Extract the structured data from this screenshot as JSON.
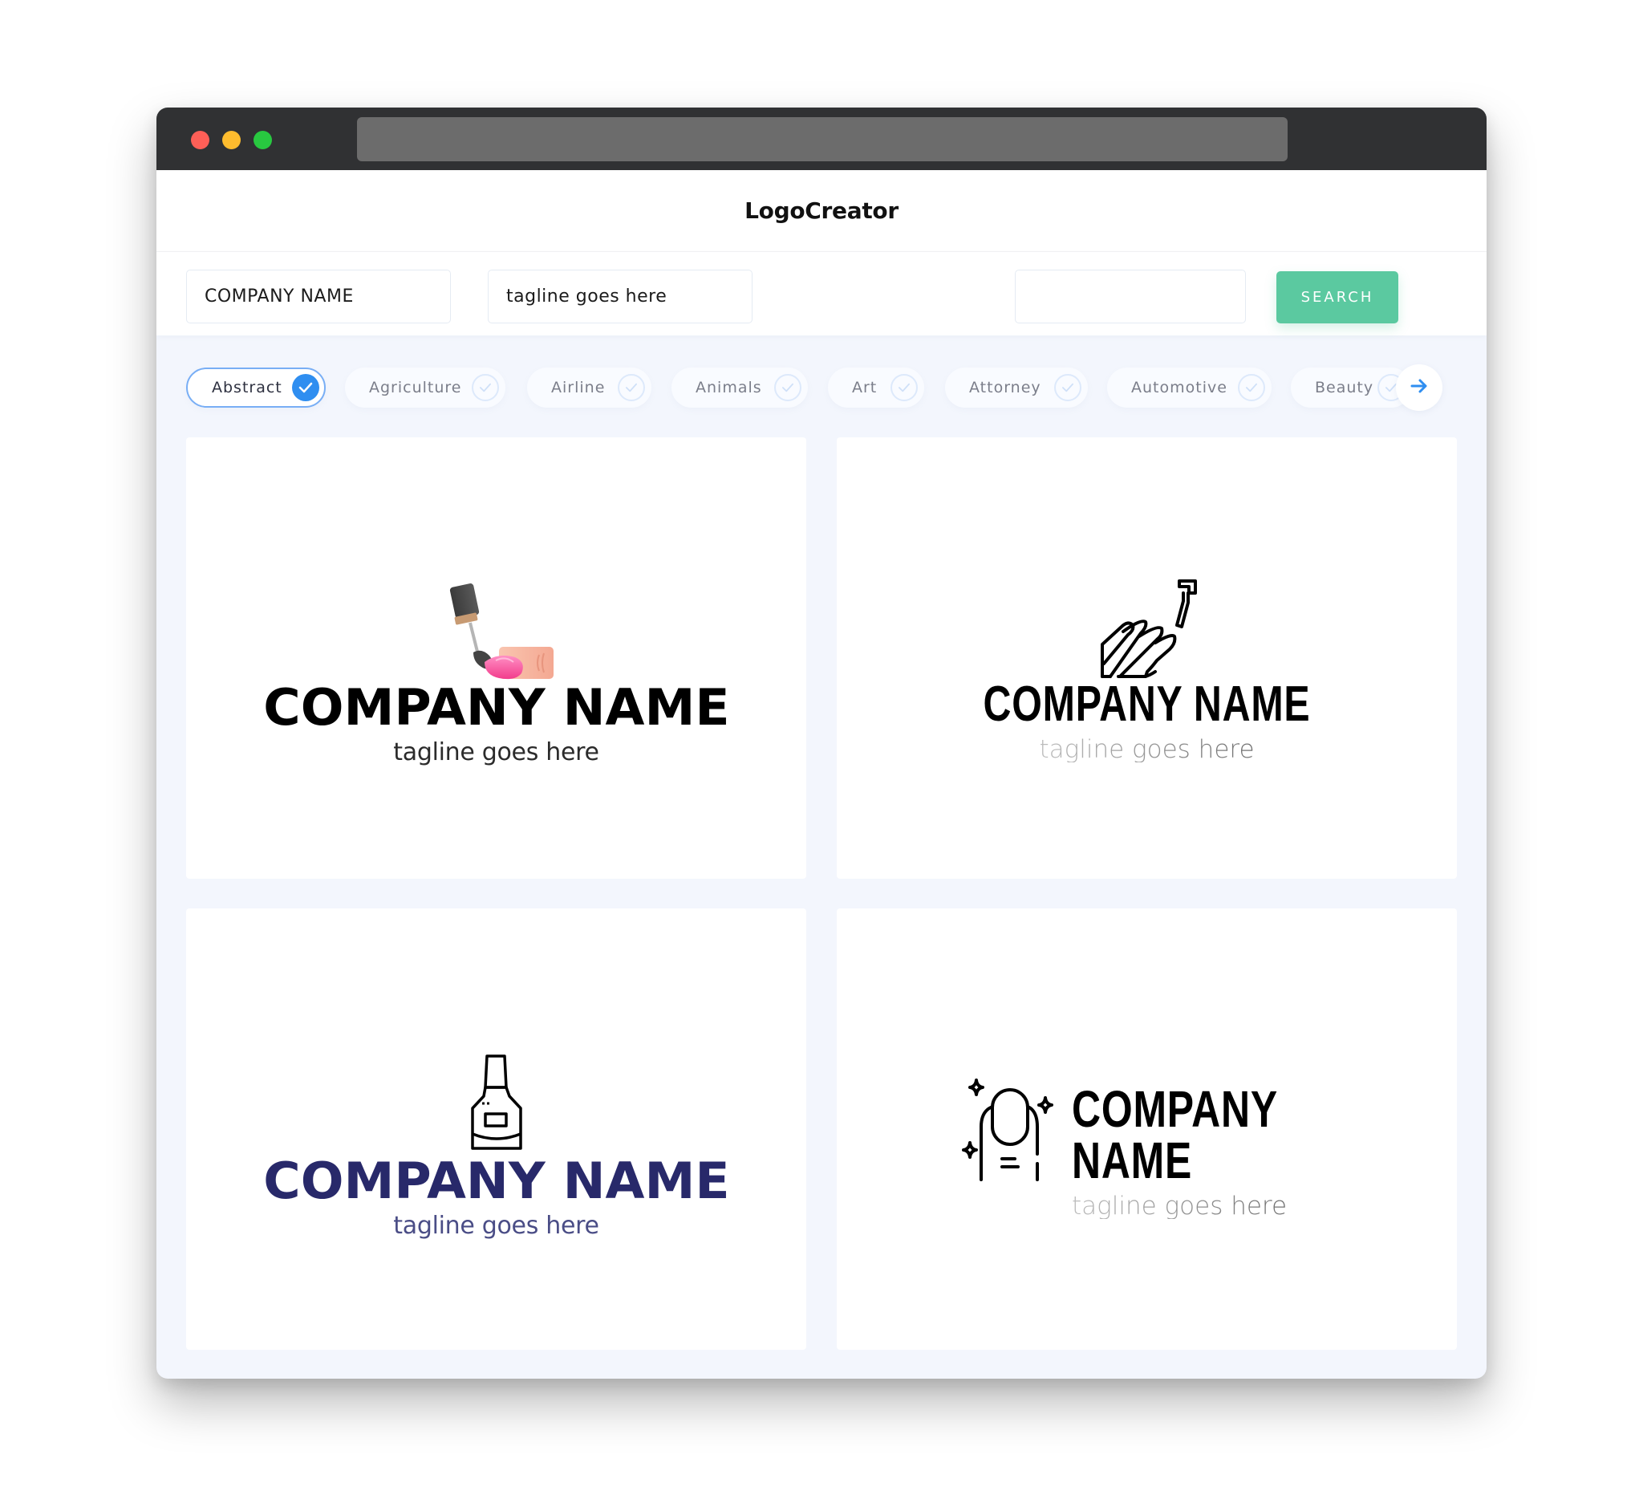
{
  "app": {
    "title": "LogoCreator"
  },
  "search": {
    "company_name_value": "COMPANY NAME",
    "tagline_value": "tagline goes here",
    "keyword_value": "",
    "search_label": "SEARCH"
  },
  "categories": [
    {
      "label": "Abstract",
      "selected": true
    },
    {
      "label": "Agriculture",
      "selected": false
    },
    {
      "label": "Airline",
      "selected": false
    },
    {
      "label": "Animals",
      "selected": false
    },
    {
      "label": "Art",
      "selected": false
    },
    {
      "label": "Attorney",
      "selected": false
    },
    {
      "label": "Automotive",
      "selected": false
    },
    {
      "label": "Beauty",
      "selected": false
    }
  ],
  "next_icon": "arrow-right-icon",
  "logos": [
    {
      "icon": "nail-polish-brush-icon",
      "company_name": "COMPANY NAME",
      "tagline": "tagline goes here",
      "name_color": "#000000",
      "tagline_color": "#2b2b2b"
    },
    {
      "icon": "manicure-hand-icon",
      "company_name": "COMPANY NAME",
      "tagline": "tagline goes here",
      "name_color": "#000000",
      "tagline_color": "#9a9a9a"
    },
    {
      "icon": "nail-polish-bottle-icon",
      "company_name": "COMPANY NAME",
      "tagline": "tagline goes here",
      "name_color": "#28296a",
      "tagline_color": "#4a4d86"
    },
    {
      "icon": "sparkling-nail-icon",
      "company_name": "COMPANY NAME",
      "tagline": "tagline goes here",
      "name_color": "#000000",
      "tagline_color": "#9a9a9a"
    }
  ],
  "colors": {
    "accent": "#2f8ef0",
    "search_button": "#5bc9a0",
    "titlebar": "#303133",
    "page_background": "#f3f6fd"
  }
}
